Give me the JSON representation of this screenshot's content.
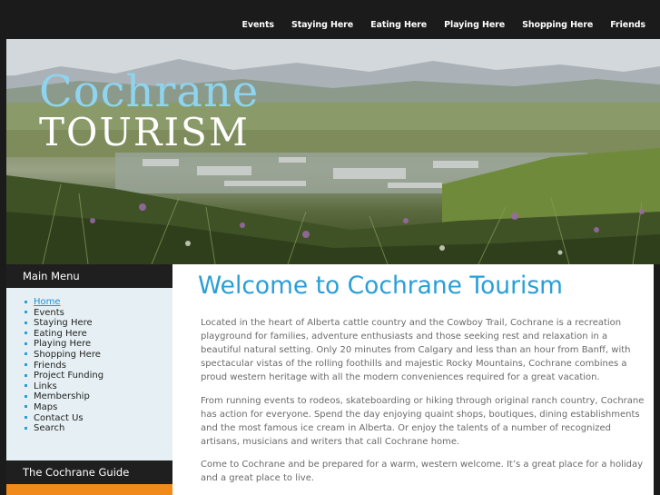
{
  "top_nav": {
    "items": [
      "Events",
      "Staying Here",
      "Eating Here",
      "Playing Here",
      "Shopping Here",
      "Friends"
    ]
  },
  "banner": {
    "logo_line1": "Cochrane",
    "logo_line2": "TOURISM",
    "image": "cochrane-landscape-photo"
  },
  "sidebar": {
    "menu_title": "Main Menu",
    "items": [
      "Home",
      "Events",
      "Staying Here",
      "Eating Here",
      "Playing Here",
      "Shopping Here",
      "Friends",
      "Project Funding",
      "Links",
      "Membership",
      "Maps",
      "Contact Us",
      "Search"
    ],
    "active_item": "Home",
    "guide_title": "The Cochrane Guide"
  },
  "main": {
    "title": "Welcome to Cochrane Tourism",
    "paragraphs": [
      "Located in the heart of Alberta cattle country and the Cowboy Trail, Cochrane is a recreation playground for families, adventure enthusiasts and those seeking rest and relaxation in a beautiful natural setting. Only 20 minutes from Calgary and less than an hour from Banff, with spectacular vistas of the rolling foothills and majestic Rocky Mountains, Cochrane combines a proud western heritage with all the modern conveniences required for a great vacation.",
      "From running events to rodeos, skateboarding or hiking through original ranch country, Cochrane has action for everyone. Spend the day enjoying quaint shops, boutiques, dining establishments and the most famous ice cream in Alberta. Or enjoy the talents of a number of recognized artisans, musicians and writers that call Cochrane home.",
      "Come to Cochrane and be prepared for a warm, western welcome.  It’s a great place for a holiday and a great place to live."
    ]
  },
  "colors": {
    "accent": "#2a9fd6",
    "dark_bar": "#1f1f1f",
    "sidebar_bg": "#e6f0f4",
    "logo_blue": "#8fd4ef",
    "orange": "#f08a1a"
  }
}
